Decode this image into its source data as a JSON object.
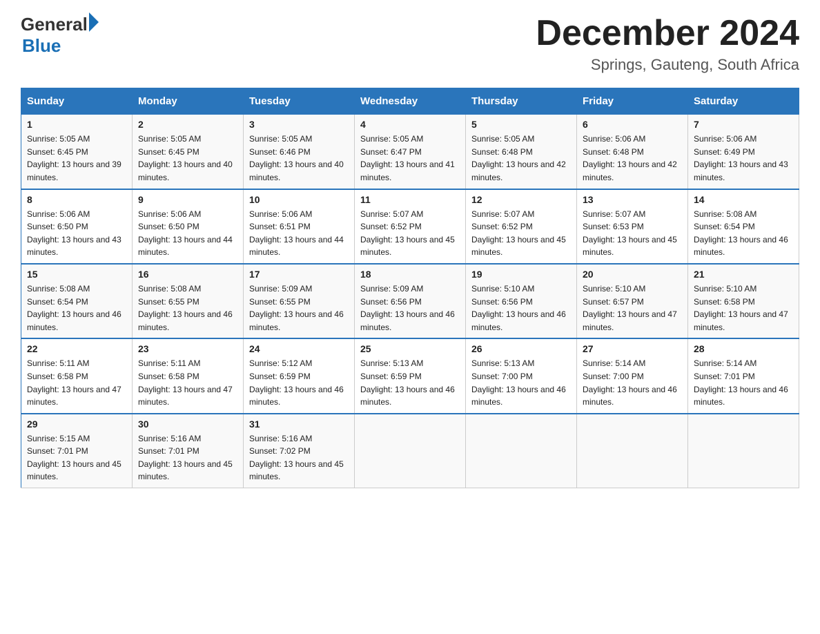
{
  "header": {
    "logo": {
      "general": "General",
      "blue": "Blue",
      "arrow": "▶"
    },
    "title": "December 2024",
    "location": "Springs, Gauteng, South Africa"
  },
  "days_of_week": [
    "Sunday",
    "Monday",
    "Tuesday",
    "Wednesday",
    "Thursday",
    "Friday",
    "Saturday"
  ],
  "weeks": [
    [
      {
        "date": "1",
        "sunrise": "5:05 AM",
        "sunset": "6:45 PM",
        "daylight": "13 hours and 39 minutes."
      },
      {
        "date": "2",
        "sunrise": "5:05 AM",
        "sunset": "6:45 PM",
        "daylight": "13 hours and 40 minutes."
      },
      {
        "date": "3",
        "sunrise": "5:05 AM",
        "sunset": "6:46 PM",
        "daylight": "13 hours and 40 minutes."
      },
      {
        "date": "4",
        "sunrise": "5:05 AM",
        "sunset": "6:47 PM",
        "daylight": "13 hours and 41 minutes."
      },
      {
        "date": "5",
        "sunrise": "5:05 AM",
        "sunset": "6:48 PM",
        "daylight": "13 hours and 42 minutes."
      },
      {
        "date": "6",
        "sunrise": "5:06 AM",
        "sunset": "6:48 PM",
        "daylight": "13 hours and 42 minutes."
      },
      {
        "date": "7",
        "sunrise": "5:06 AM",
        "sunset": "6:49 PM",
        "daylight": "13 hours and 43 minutes."
      }
    ],
    [
      {
        "date": "8",
        "sunrise": "5:06 AM",
        "sunset": "6:50 PM",
        "daylight": "13 hours and 43 minutes."
      },
      {
        "date": "9",
        "sunrise": "5:06 AM",
        "sunset": "6:50 PM",
        "daylight": "13 hours and 44 minutes."
      },
      {
        "date": "10",
        "sunrise": "5:06 AM",
        "sunset": "6:51 PM",
        "daylight": "13 hours and 44 minutes."
      },
      {
        "date": "11",
        "sunrise": "5:07 AM",
        "sunset": "6:52 PM",
        "daylight": "13 hours and 45 minutes."
      },
      {
        "date": "12",
        "sunrise": "5:07 AM",
        "sunset": "6:52 PM",
        "daylight": "13 hours and 45 minutes."
      },
      {
        "date": "13",
        "sunrise": "5:07 AM",
        "sunset": "6:53 PM",
        "daylight": "13 hours and 45 minutes."
      },
      {
        "date": "14",
        "sunrise": "5:08 AM",
        "sunset": "6:54 PM",
        "daylight": "13 hours and 46 minutes."
      }
    ],
    [
      {
        "date": "15",
        "sunrise": "5:08 AM",
        "sunset": "6:54 PM",
        "daylight": "13 hours and 46 minutes."
      },
      {
        "date": "16",
        "sunrise": "5:08 AM",
        "sunset": "6:55 PM",
        "daylight": "13 hours and 46 minutes."
      },
      {
        "date": "17",
        "sunrise": "5:09 AM",
        "sunset": "6:55 PM",
        "daylight": "13 hours and 46 minutes."
      },
      {
        "date": "18",
        "sunrise": "5:09 AM",
        "sunset": "6:56 PM",
        "daylight": "13 hours and 46 minutes."
      },
      {
        "date": "19",
        "sunrise": "5:10 AM",
        "sunset": "6:56 PM",
        "daylight": "13 hours and 46 minutes."
      },
      {
        "date": "20",
        "sunrise": "5:10 AM",
        "sunset": "6:57 PM",
        "daylight": "13 hours and 47 minutes."
      },
      {
        "date": "21",
        "sunrise": "5:10 AM",
        "sunset": "6:58 PM",
        "daylight": "13 hours and 47 minutes."
      }
    ],
    [
      {
        "date": "22",
        "sunrise": "5:11 AM",
        "sunset": "6:58 PM",
        "daylight": "13 hours and 47 minutes."
      },
      {
        "date": "23",
        "sunrise": "5:11 AM",
        "sunset": "6:58 PM",
        "daylight": "13 hours and 47 minutes."
      },
      {
        "date": "24",
        "sunrise": "5:12 AM",
        "sunset": "6:59 PM",
        "daylight": "13 hours and 46 minutes."
      },
      {
        "date": "25",
        "sunrise": "5:13 AM",
        "sunset": "6:59 PM",
        "daylight": "13 hours and 46 minutes."
      },
      {
        "date": "26",
        "sunrise": "5:13 AM",
        "sunset": "7:00 PM",
        "daylight": "13 hours and 46 minutes."
      },
      {
        "date": "27",
        "sunrise": "5:14 AM",
        "sunset": "7:00 PM",
        "daylight": "13 hours and 46 minutes."
      },
      {
        "date": "28",
        "sunrise": "5:14 AM",
        "sunset": "7:01 PM",
        "daylight": "13 hours and 46 minutes."
      }
    ],
    [
      {
        "date": "29",
        "sunrise": "5:15 AM",
        "sunset": "7:01 PM",
        "daylight": "13 hours and 45 minutes."
      },
      {
        "date": "30",
        "sunrise": "5:16 AM",
        "sunset": "7:01 PM",
        "daylight": "13 hours and 45 minutes."
      },
      {
        "date": "31",
        "sunrise": "5:16 AM",
        "sunset": "7:02 PM",
        "daylight": "13 hours and 45 minutes."
      },
      {
        "date": "",
        "sunrise": "",
        "sunset": "",
        "daylight": ""
      },
      {
        "date": "",
        "sunrise": "",
        "sunset": "",
        "daylight": ""
      },
      {
        "date": "",
        "sunrise": "",
        "sunset": "",
        "daylight": ""
      },
      {
        "date": "",
        "sunrise": "",
        "sunset": "",
        "daylight": ""
      }
    ]
  ]
}
